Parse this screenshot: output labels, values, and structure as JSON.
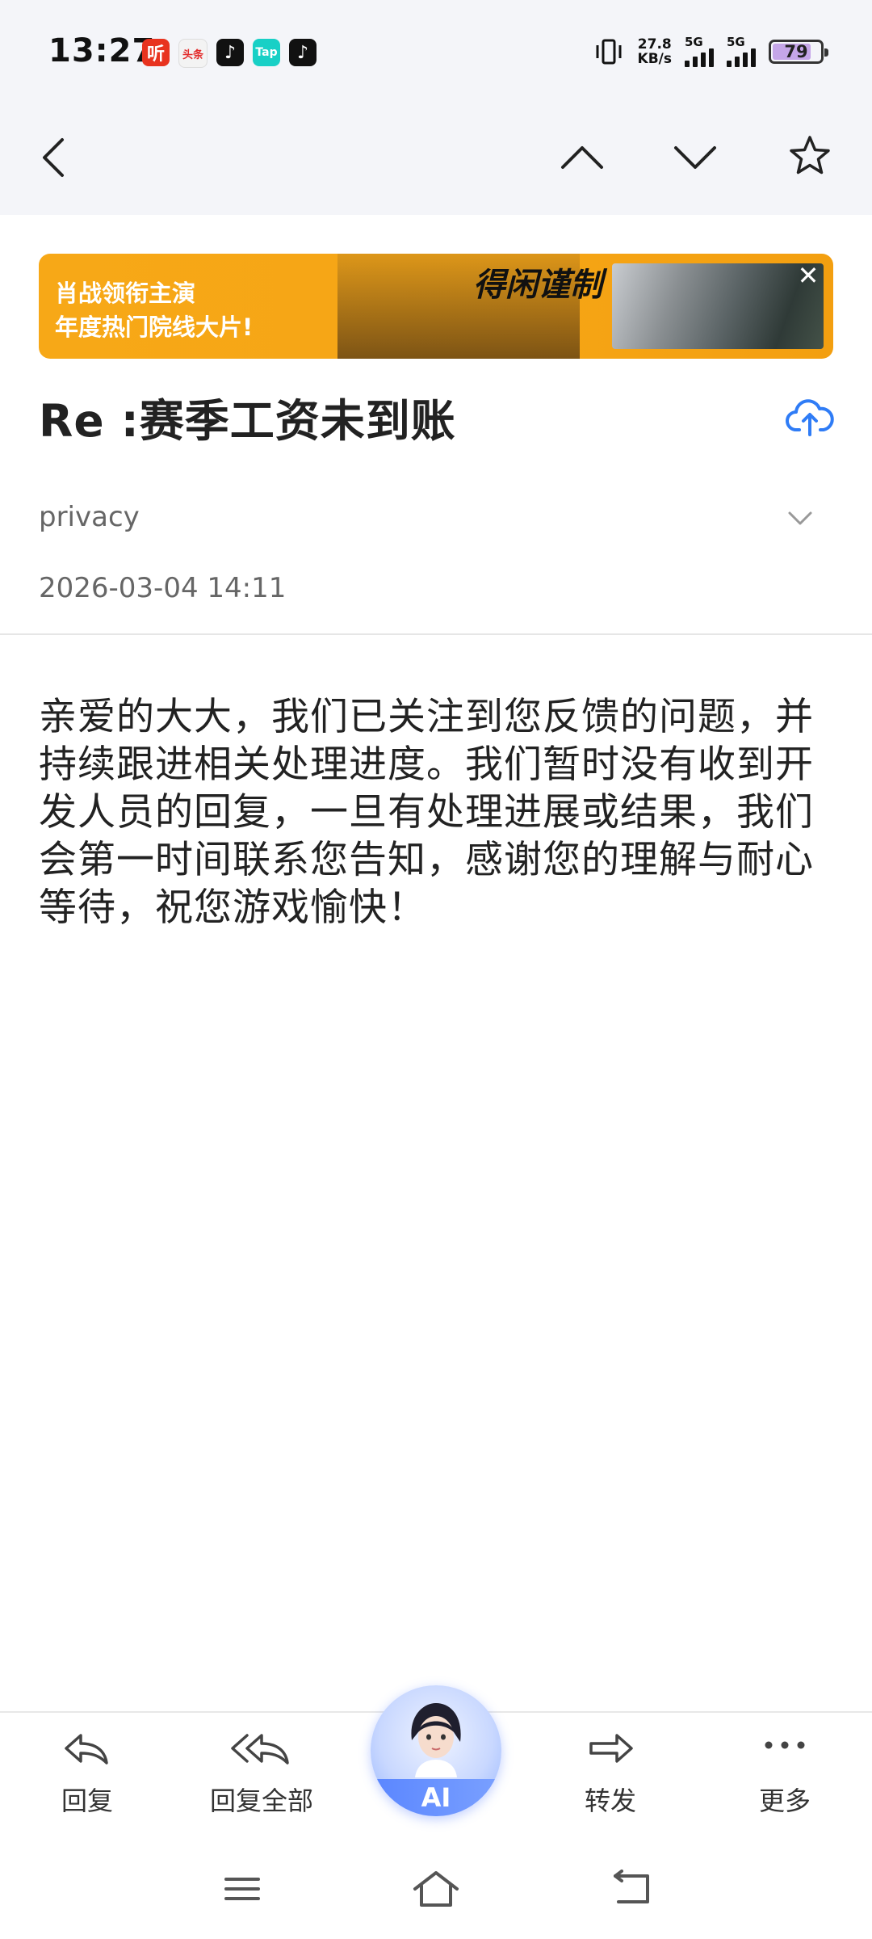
{
  "status_bar": {
    "time": "13:27",
    "app_icons": [
      "ting-app-icon",
      "toutiao-app-icon",
      "tiktok-app-icon",
      "tap-app-icon",
      "tiktok-lite-app-icon"
    ],
    "app_icon_text": {
      "ting": "听",
      "toutiao": "头条",
      "tap": "Tap"
    },
    "speed_value": "27.8",
    "speed_unit": "KB/s",
    "net1_label": "5G",
    "net2_label": "5G",
    "battery": "79"
  },
  "nav": {
    "back_icon": "chevron-left-icon",
    "prev_icon": "chevron-up-icon",
    "next_icon": "chevron-down-icon",
    "star_icon": "star-icon"
  },
  "ad": {
    "line1": "肖战领衔主演",
    "line2": "年度热门院线大片!",
    "film_title": "得闲谨制",
    "close": "✕"
  },
  "email": {
    "subject": "Re :赛季工资未到账",
    "sender": "privacy",
    "date": "2026-03-04 14:11",
    "body": "亲爱的大大，我们已关注到您反馈的问题，并持续跟进相关处理进度。我们暂时没有收到开发人员的回复，一旦有处理进展或结果，我们会第一时间联系您告知，感谢您的理解与耐心等待，祝您游戏愉快！"
  },
  "toolbar": {
    "reply": "回复",
    "reply_all": "回复全部",
    "ai": "AI",
    "forward": "转发",
    "more": "更多"
  },
  "colors": {
    "accent_blue": "#2f7cf6",
    "ad_orange": "#f7a817",
    "battery_fill": "#c5a6e8"
  }
}
